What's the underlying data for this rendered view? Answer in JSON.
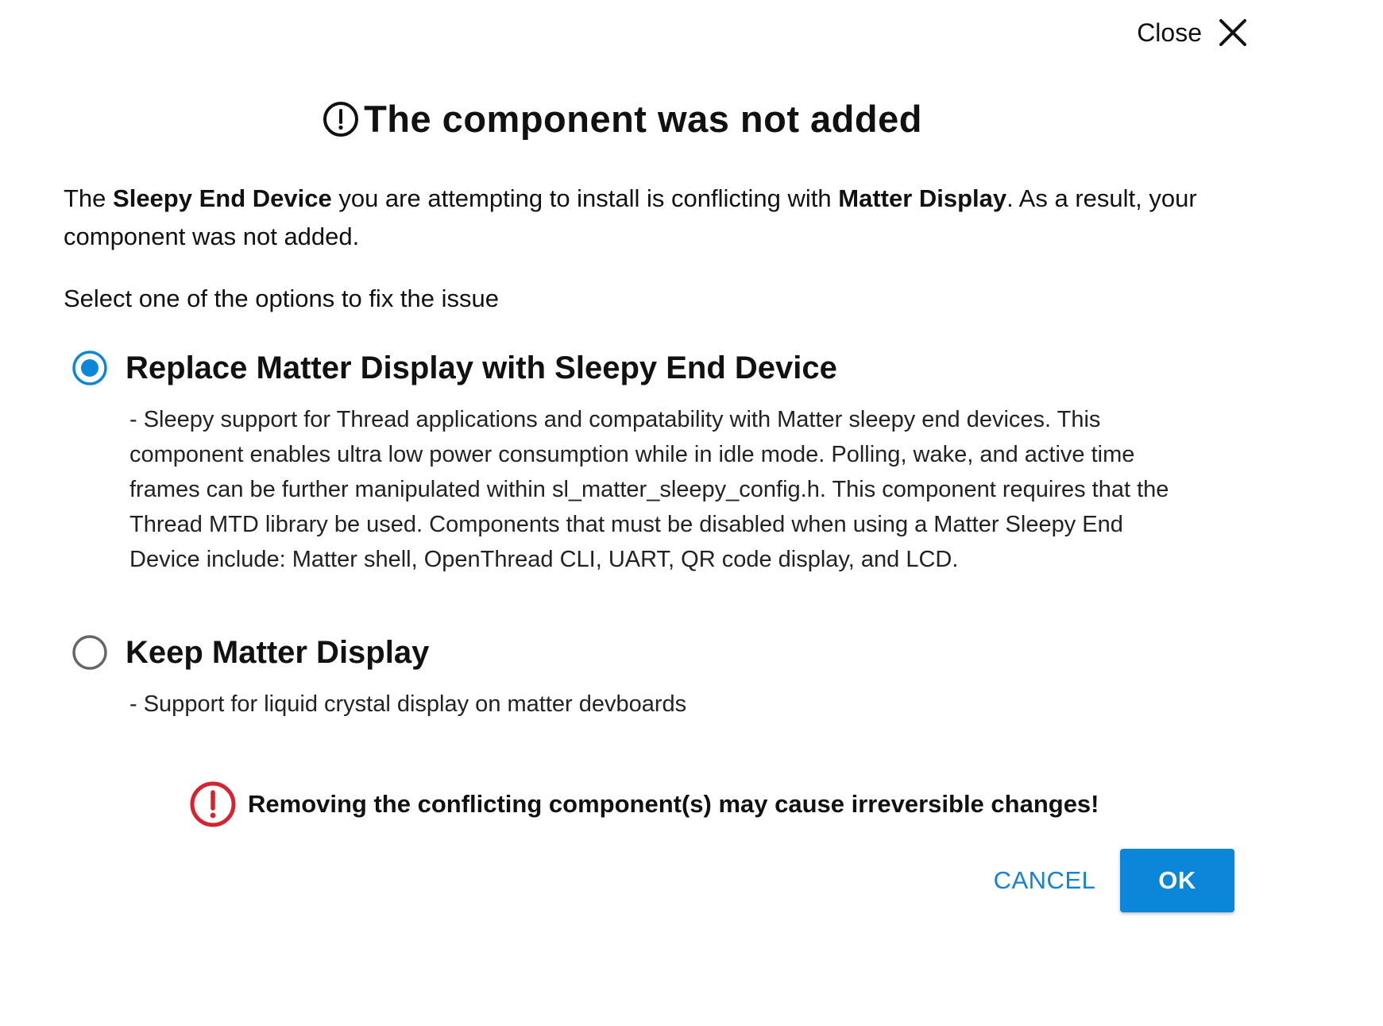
{
  "header": {
    "close_label": "Close",
    "close_icon": "close-x-icon",
    "title": "The component was not added",
    "title_icon": "exclamation-circle-icon"
  },
  "intro": {
    "prefix": "The ",
    "component": "Sleepy End Device",
    "middle": " you are attempting to install is conflicting with ",
    "conflict": "Matter Display",
    "suffix": ". As a result, your component was not added."
  },
  "select_prompt": "Select one of the options to fix the issue",
  "options": [
    {
      "title": "Replace Matter Display with Sleepy End Device",
      "selected": true,
      "description": "- Sleepy support for Thread applications and compatability with Matter sleepy end devices. This component enables ultra low power consumption while in idle mode. Polling, wake, and active time frames can be further manipulated within sl_matter_sleepy_config.h. This component requires that the Thread MTD library be used. Components that must be disabled when using a Matter Sleepy End Device include: Matter shell, OpenThread CLI, UART, QR code display, and LCD."
    },
    {
      "title": "Keep Matter Display",
      "selected": false,
      "description": "- Support for liquid crystal display on matter devboards"
    }
  ],
  "warning": {
    "icon": "warning-exclamation-circle-icon",
    "text": "Removing the conflicting component(s) may cause irreversible changes!"
  },
  "actions": {
    "cancel_label": "CANCEL",
    "ok_label": "OK"
  },
  "colors": {
    "accent": "#0b86d9",
    "link": "#1480d8",
    "warning": "#d6232f",
    "radio_unselected": "#666666"
  }
}
